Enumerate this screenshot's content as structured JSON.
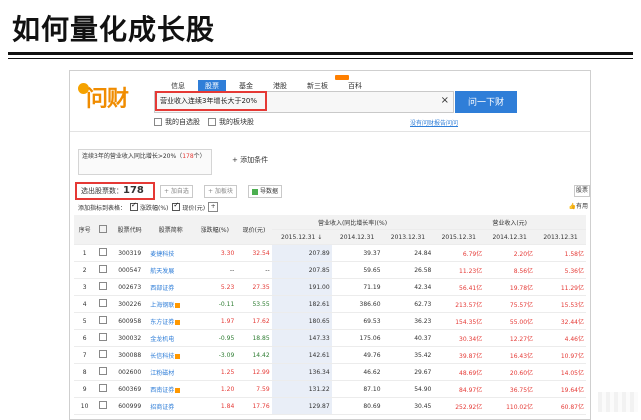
{
  "page": {
    "title": "如何量化成长股"
  },
  "nav": {
    "items": [
      "信息",
      "股票",
      "基金",
      "港股",
      "新三板",
      "百科"
    ],
    "active_index": 1
  },
  "logo": {
    "text": "问财"
  },
  "search": {
    "value": "营业收入连续3年增长大于20%",
    "clear_icon": "close-icon",
    "button_label": "问一下财"
  },
  "options": {
    "my_watchlist": "我的自选股",
    "my_board_stocks": "我的板块股",
    "feedback_link": "没有问财报告问问"
  },
  "condition": {
    "text_prefix": "连续3年的营业收入同比增长>20%（",
    "count": "178",
    "text_suffix": "个）",
    "add_label": "+ 添加条件"
  },
  "toolbar": {
    "count_label": "选出股票数：",
    "count_value": "178",
    "add_watch": "+ 加自选",
    "add_board": "+ 加板块",
    "export": "导数据",
    "stock_btn": "股票",
    "useful": "有用",
    "add_indicator_label": "添加指标到表格：",
    "chg_label": "涨跌幅(%)",
    "price_label": "现价(元)",
    "plus": "+"
  },
  "table": {
    "group_headers": [
      "营业收入(同比增长率)(%)",
      "营业收入(元)"
    ],
    "headers": [
      "序号",
      "股票代码",
      "股票简称",
      "涨跌幅(%)",
      "现价(元)",
      "2015.12.31 ↓",
      "2014.12.31",
      "2013.12.31",
      "2015.12.31",
      "2014.12.31",
      "2013.12.31"
    ],
    "rows": [
      {
        "idx": "1",
        "code": "300319",
        "name": "麦捷科技",
        "chg": "3.30",
        "price": "32.54",
        "g15": "207.89",
        "g14": "39.37",
        "g13": "24.84",
        "r15": "6.79亿",
        "r14": "2.20亿",
        "r13": "1.58亿",
        "dir": "up",
        "spk": false
      },
      {
        "idx": "2",
        "code": "000547",
        "name": "航天发展",
        "chg": "--",
        "price": "--",
        "g15": "207.85",
        "g14": "59.65",
        "g13": "26.58",
        "r15": "11.23亿",
        "r14": "8.56亿",
        "r13": "5.36亿",
        "dir": "none",
        "spk": false
      },
      {
        "idx": "3",
        "code": "002673",
        "name": "西部证券",
        "chg": "5.23",
        "price": "27.35",
        "g15": "191.00",
        "g14": "71.19",
        "g13": "42.34",
        "r15": "56.41亿",
        "r14": "19.78亿",
        "r13": "11.29亿",
        "dir": "up",
        "spk": false
      },
      {
        "idx": "4",
        "code": "300226",
        "name": "上海钢联",
        "chg": "-0.11",
        "price": "53.55",
        "g15": "182.61",
        "g14": "386.60",
        "g13": "62.73",
        "r15": "213.57亿",
        "r14": "75.57亿",
        "r13": "15.53亿",
        "dir": "down",
        "spk": true
      },
      {
        "idx": "5",
        "code": "600958",
        "name": "东方证券",
        "chg": "1.97",
        "price": "17.62",
        "g15": "180.65",
        "g14": "69.53",
        "g13": "36.23",
        "r15": "154.35亿",
        "r14": "55.00亿",
        "r13": "32.44亿",
        "dir": "up",
        "spk": true
      },
      {
        "idx": "6",
        "code": "300032",
        "name": "金龙机电",
        "chg": "-0.95",
        "price": "18.85",
        "g15": "147.33",
        "g14": "175.06",
        "g13": "40.37",
        "r15": "30.34亿",
        "r14": "12.27亿",
        "r13": "4.46亿",
        "dir": "down",
        "spk": false
      },
      {
        "idx": "7",
        "code": "300088",
        "name": "长信科技",
        "chg": "-3.09",
        "price": "14.42",
        "g15": "142.61",
        "g14": "49.76",
        "g13": "35.42",
        "r15": "39.87亿",
        "r14": "16.43亿",
        "r13": "10.97亿",
        "dir": "down",
        "spk": true
      },
      {
        "idx": "8",
        "code": "002600",
        "name": "江粉磁材",
        "chg": "1.25",
        "price": "12.99",
        "g15": "136.34",
        "g14": "46.62",
        "g13": "29.67",
        "r15": "48.69亿",
        "r14": "20.60亿",
        "r13": "14.05亿",
        "dir": "up",
        "spk": false
      },
      {
        "idx": "9",
        "code": "600369",
        "name": "西南证券",
        "chg": "1.20",
        "price": "7.59",
        "g15": "131.22",
        "g14": "87.10",
        "g13": "54.90",
        "r15": "84.97亿",
        "r14": "36.75亿",
        "r13": "19.64亿",
        "dir": "up",
        "spk": true
      },
      {
        "idx": "10",
        "code": "600999",
        "name": "招商证券",
        "chg": "1.84",
        "price": "17.76",
        "g15": "129.87",
        "g14": "80.69",
        "g13": "30.45",
        "r15": "252.92亿",
        "r14": "110.02亿",
        "r13": "60.87亿",
        "dir": "up",
        "spk": false
      }
    ]
  },
  "colors": {
    "accent": "#2f7ed8",
    "up": "#e53935",
    "down": "#2e7d32",
    "logo": "#f08c00"
  }
}
